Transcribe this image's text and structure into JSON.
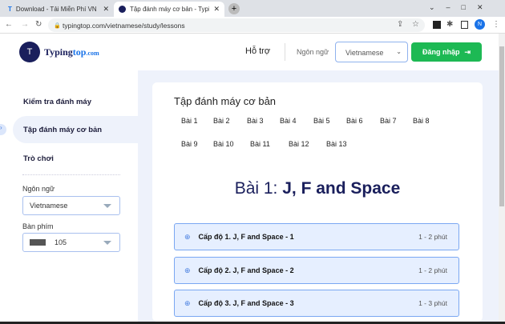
{
  "browser": {
    "tabs": [
      {
        "label": "Download - Tải Miễn Phí VN - Ph",
        "close": "✕"
      },
      {
        "label": "Tập đánh máy cơ bản - TypingTo",
        "close": "✕"
      }
    ],
    "new_tab": "+",
    "url": "typingtop.com/vietnamese/study/lessons",
    "profile": "N"
  },
  "header": {
    "logo_typing": "Typing",
    "logo_top": "top",
    "logo_com": ".com",
    "support": "Hỗ trợ",
    "language_label": "Ngôn ngữ",
    "language_value": "Vietnamese",
    "login": "Đăng nhập"
  },
  "sidebar": {
    "items": [
      {
        "label": "Kiểm tra đánh máy"
      },
      {
        "label": "Tập đánh máy cơ bản"
      },
      {
        "label": "Trò chơi"
      }
    ],
    "language_label": "Ngôn ngữ",
    "language_value": "Vietnamese",
    "keyboard_label": "Bàn phím",
    "keyboard_value": "105"
  },
  "main": {
    "title": "Tập đánh máy cơ bản",
    "lessons": [
      "Bài 1",
      "Bài 2",
      "Bài 3",
      "Bài 4",
      "Bài 5",
      "Bài 6",
      "Bài 7",
      "Bài 8",
      "Bài 9",
      "Bài 10",
      "Bài 11",
      "Bài 12",
      "Bài 13"
    ],
    "lesson_heading_prefix": "Bài 1:",
    "lesson_heading": "J, F and Space",
    "levels": [
      {
        "title": "Cấp độ 1. J, F and Space - 1",
        "duration": "1 - 2 phút"
      },
      {
        "title": "Cấp độ 2. J, F and Space - 2",
        "duration": "1 - 2 phút"
      },
      {
        "title": "Cấp độ 3. J, F and Space - 3",
        "duration": "1 - 3 phút"
      }
    ]
  },
  "colors": {
    "accent": "#1a1f5c",
    "green": "#1db954",
    "item_bg": "#e6efff",
    "item_border": "#7aa7f2"
  }
}
